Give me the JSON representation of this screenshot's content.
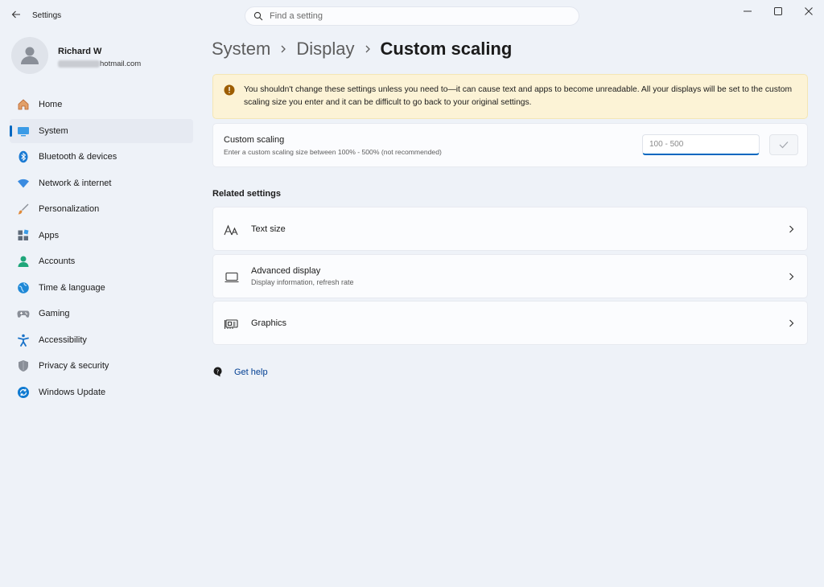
{
  "window": {
    "title": "Settings",
    "controls": [
      "minimize",
      "maximize",
      "close"
    ]
  },
  "search": {
    "placeholder": "Find a setting"
  },
  "profile": {
    "name": "Richard W",
    "email_visible": "hotmail.com"
  },
  "sidebar": {
    "items": [
      {
        "label": "Home",
        "icon": "home-icon",
        "color": "#c26b2e"
      },
      {
        "label": "System",
        "icon": "system-icon",
        "color": "#0078d4",
        "active": true
      },
      {
        "label": "Bluetooth & devices",
        "icon": "bluetooth-icon",
        "color": "#0078d4"
      },
      {
        "label": "Network & internet",
        "icon": "wifi-icon",
        "color": "#3a8be0"
      },
      {
        "label": "Personalization",
        "icon": "brush-icon",
        "color": "#d07b33"
      },
      {
        "label": "Apps",
        "icon": "apps-icon",
        "color": "#5f6b7a"
      },
      {
        "label": "Accounts",
        "icon": "accounts-icon",
        "color": "#1fa67a"
      },
      {
        "label": "Time & language",
        "icon": "globe-icon",
        "color": "#1e88d6"
      },
      {
        "label": "Gaming",
        "icon": "gamepad-icon",
        "color": "#7a7f88"
      },
      {
        "label": "Accessibility",
        "icon": "accessibility-icon",
        "color": "#1a73c9"
      },
      {
        "label": "Privacy & security",
        "icon": "shield-icon",
        "color": "#7c838e"
      },
      {
        "label": "Windows Update",
        "icon": "update-icon",
        "color": "#0f7ad1"
      }
    ]
  },
  "breadcrumb": {
    "items": [
      "System",
      "Display"
    ],
    "current": "Custom scaling"
  },
  "warning": {
    "text": "You shouldn't change these settings unless you need to—it can cause text and apps to become unreadable. All your displays will be set to the custom scaling size you enter and it can be difficult to go back to your original settings."
  },
  "custom_scaling": {
    "title": "Custom scaling",
    "subtitle": "Enter a custom scaling size between 100% - 500% (not recommended)",
    "input_placeholder": "100 - 500"
  },
  "related": {
    "heading": "Related settings",
    "items": [
      {
        "title": "Text size",
        "subtitle": "",
        "icon": "text-size-icon"
      },
      {
        "title": "Advanced display",
        "subtitle": "Display information, refresh rate",
        "icon": "monitor-icon"
      },
      {
        "title": "Graphics",
        "subtitle": "",
        "icon": "graphics-card-icon"
      }
    ]
  },
  "help": {
    "label": "Get help"
  },
  "colors": {
    "accent": "#0067c0",
    "warning_bg": "#fcf3d6",
    "warning_icon": "#9d5d00"
  }
}
